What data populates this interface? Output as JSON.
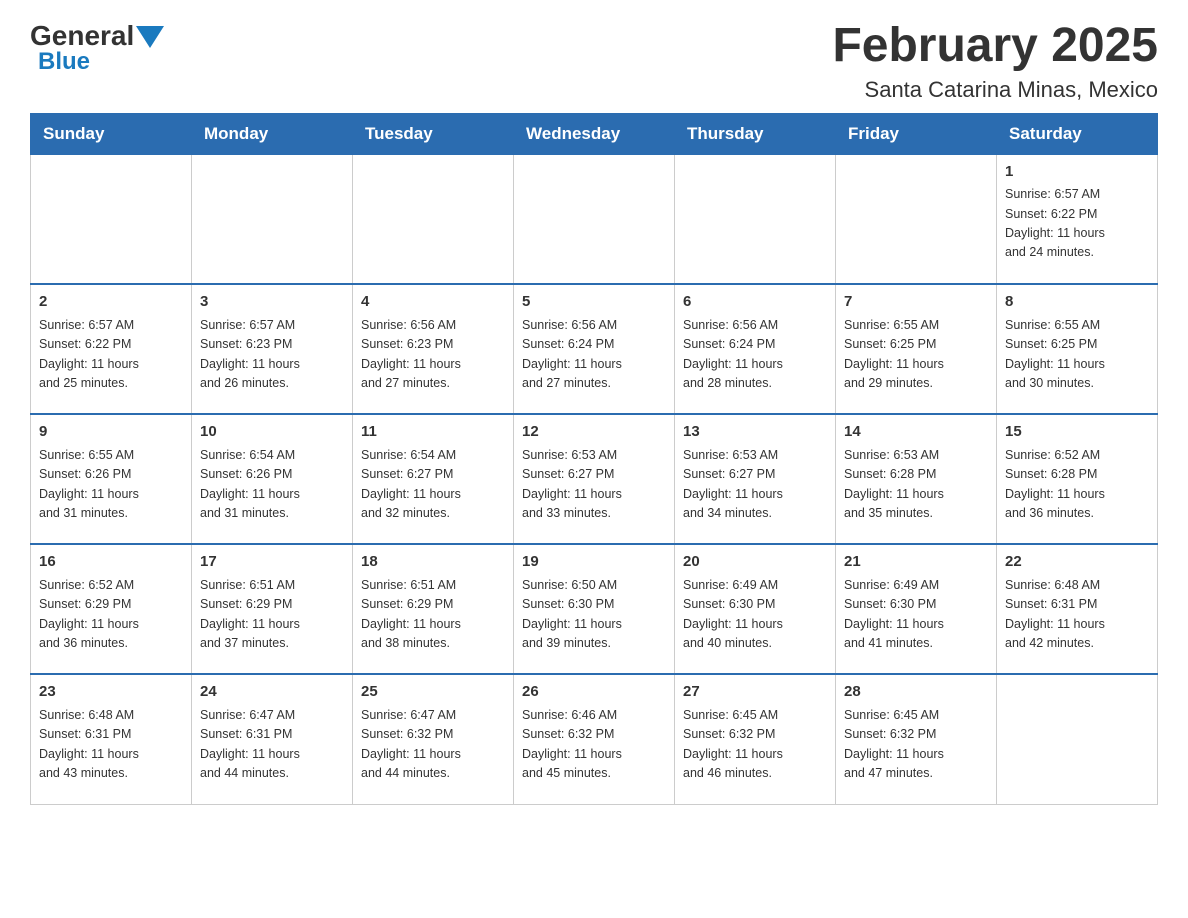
{
  "header": {
    "logo_general": "General",
    "logo_blue": "Blue",
    "title": "February 2025",
    "subtitle": "Santa Catarina Minas, Mexico"
  },
  "days_of_week": [
    "Sunday",
    "Monday",
    "Tuesday",
    "Wednesday",
    "Thursday",
    "Friday",
    "Saturday"
  ],
  "weeks": [
    [
      {
        "day": "",
        "info": ""
      },
      {
        "day": "",
        "info": ""
      },
      {
        "day": "",
        "info": ""
      },
      {
        "day": "",
        "info": ""
      },
      {
        "day": "",
        "info": ""
      },
      {
        "day": "",
        "info": ""
      },
      {
        "day": "1",
        "info": "Sunrise: 6:57 AM\nSunset: 6:22 PM\nDaylight: 11 hours\nand 24 minutes."
      }
    ],
    [
      {
        "day": "2",
        "info": "Sunrise: 6:57 AM\nSunset: 6:22 PM\nDaylight: 11 hours\nand 25 minutes."
      },
      {
        "day": "3",
        "info": "Sunrise: 6:57 AM\nSunset: 6:23 PM\nDaylight: 11 hours\nand 26 minutes."
      },
      {
        "day": "4",
        "info": "Sunrise: 6:56 AM\nSunset: 6:23 PM\nDaylight: 11 hours\nand 27 minutes."
      },
      {
        "day": "5",
        "info": "Sunrise: 6:56 AM\nSunset: 6:24 PM\nDaylight: 11 hours\nand 27 minutes."
      },
      {
        "day": "6",
        "info": "Sunrise: 6:56 AM\nSunset: 6:24 PM\nDaylight: 11 hours\nand 28 minutes."
      },
      {
        "day": "7",
        "info": "Sunrise: 6:55 AM\nSunset: 6:25 PM\nDaylight: 11 hours\nand 29 minutes."
      },
      {
        "day": "8",
        "info": "Sunrise: 6:55 AM\nSunset: 6:25 PM\nDaylight: 11 hours\nand 30 minutes."
      }
    ],
    [
      {
        "day": "9",
        "info": "Sunrise: 6:55 AM\nSunset: 6:26 PM\nDaylight: 11 hours\nand 31 minutes."
      },
      {
        "day": "10",
        "info": "Sunrise: 6:54 AM\nSunset: 6:26 PM\nDaylight: 11 hours\nand 31 minutes."
      },
      {
        "day": "11",
        "info": "Sunrise: 6:54 AM\nSunset: 6:27 PM\nDaylight: 11 hours\nand 32 minutes."
      },
      {
        "day": "12",
        "info": "Sunrise: 6:53 AM\nSunset: 6:27 PM\nDaylight: 11 hours\nand 33 minutes."
      },
      {
        "day": "13",
        "info": "Sunrise: 6:53 AM\nSunset: 6:27 PM\nDaylight: 11 hours\nand 34 minutes."
      },
      {
        "day": "14",
        "info": "Sunrise: 6:53 AM\nSunset: 6:28 PM\nDaylight: 11 hours\nand 35 minutes."
      },
      {
        "day": "15",
        "info": "Sunrise: 6:52 AM\nSunset: 6:28 PM\nDaylight: 11 hours\nand 36 minutes."
      }
    ],
    [
      {
        "day": "16",
        "info": "Sunrise: 6:52 AM\nSunset: 6:29 PM\nDaylight: 11 hours\nand 36 minutes."
      },
      {
        "day": "17",
        "info": "Sunrise: 6:51 AM\nSunset: 6:29 PM\nDaylight: 11 hours\nand 37 minutes."
      },
      {
        "day": "18",
        "info": "Sunrise: 6:51 AM\nSunset: 6:29 PM\nDaylight: 11 hours\nand 38 minutes."
      },
      {
        "day": "19",
        "info": "Sunrise: 6:50 AM\nSunset: 6:30 PM\nDaylight: 11 hours\nand 39 minutes."
      },
      {
        "day": "20",
        "info": "Sunrise: 6:49 AM\nSunset: 6:30 PM\nDaylight: 11 hours\nand 40 minutes."
      },
      {
        "day": "21",
        "info": "Sunrise: 6:49 AM\nSunset: 6:30 PM\nDaylight: 11 hours\nand 41 minutes."
      },
      {
        "day": "22",
        "info": "Sunrise: 6:48 AM\nSunset: 6:31 PM\nDaylight: 11 hours\nand 42 minutes."
      }
    ],
    [
      {
        "day": "23",
        "info": "Sunrise: 6:48 AM\nSunset: 6:31 PM\nDaylight: 11 hours\nand 43 minutes."
      },
      {
        "day": "24",
        "info": "Sunrise: 6:47 AM\nSunset: 6:31 PM\nDaylight: 11 hours\nand 44 minutes."
      },
      {
        "day": "25",
        "info": "Sunrise: 6:47 AM\nSunset: 6:32 PM\nDaylight: 11 hours\nand 44 minutes."
      },
      {
        "day": "26",
        "info": "Sunrise: 6:46 AM\nSunset: 6:32 PM\nDaylight: 11 hours\nand 45 minutes."
      },
      {
        "day": "27",
        "info": "Sunrise: 6:45 AM\nSunset: 6:32 PM\nDaylight: 11 hours\nand 46 minutes."
      },
      {
        "day": "28",
        "info": "Sunrise: 6:45 AM\nSunset: 6:32 PM\nDaylight: 11 hours\nand 47 minutes."
      },
      {
        "day": "",
        "info": ""
      }
    ]
  ]
}
